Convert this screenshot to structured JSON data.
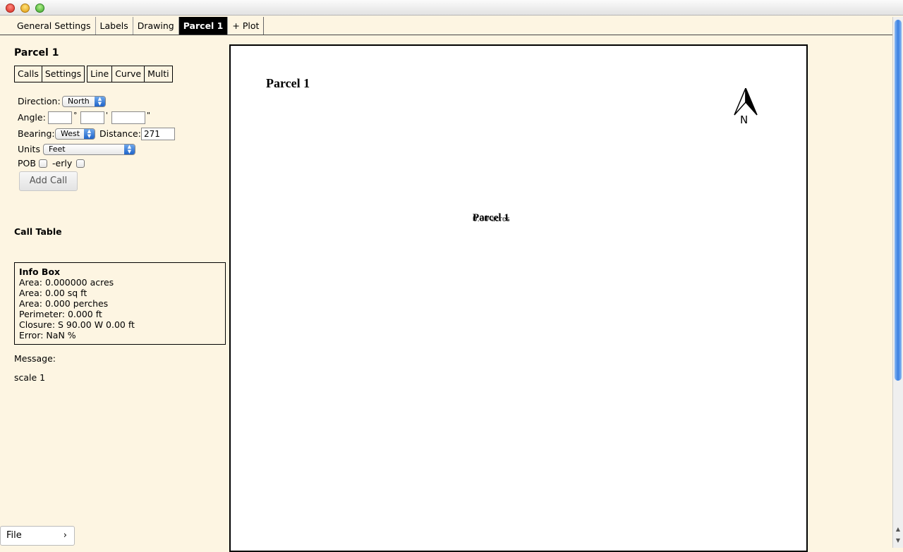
{
  "tabs": [
    "General Settings",
    "Labels",
    "Drawing",
    "Parcel 1",
    "+ Plot"
  ],
  "sidebar": {
    "title": "Parcel 1",
    "subtabs": [
      "Calls",
      "Settings",
      "Line",
      "Curve",
      "Multi"
    ],
    "direction_label": "Direction:",
    "direction_value": "North",
    "angle_label": "Angle:",
    "angle_deg": "",
    "angle_min": "",
    "angle_sec": "",
    "deg_symbol": "°",
    "min_symbol": "'",
    "sec_symbol": "\"",
    "bearing_label": "Bearing:",
    "bearing_value": "West",
    "distance_label": "Distance:",
    "distance_value": "271",
    "units_label": "Units",
    "units_value": "Feet",
    "pob_label": "POB",
    "erly_label": "-erly",
    "add_call_label": "Add Call",
    "call_table_title": "Call Table",
    "info_box": {
      "title": "Info Box",
      "lines": [
        "Area: 0.000000 acres",
        "Area: 0.00 sq ft",
        "Area: 0.000 perches",
        "Perimeter: 0.000 ft",
        "Closure: S 90.00 W 0.00 ft",
        "Error: NaN %"
      ]
    },
    "message_label": "Message:",
    "scale_text": "scale 1"
  },
  "canvas": {
    "title": "Parcel 1",
    "center_label": "Parcel 1",
    "center_area": "0.00 acres",
    "north_label": "N"
  },
  "file_button": {
    "label": "File",
    "chevron": "›"
  }
}
